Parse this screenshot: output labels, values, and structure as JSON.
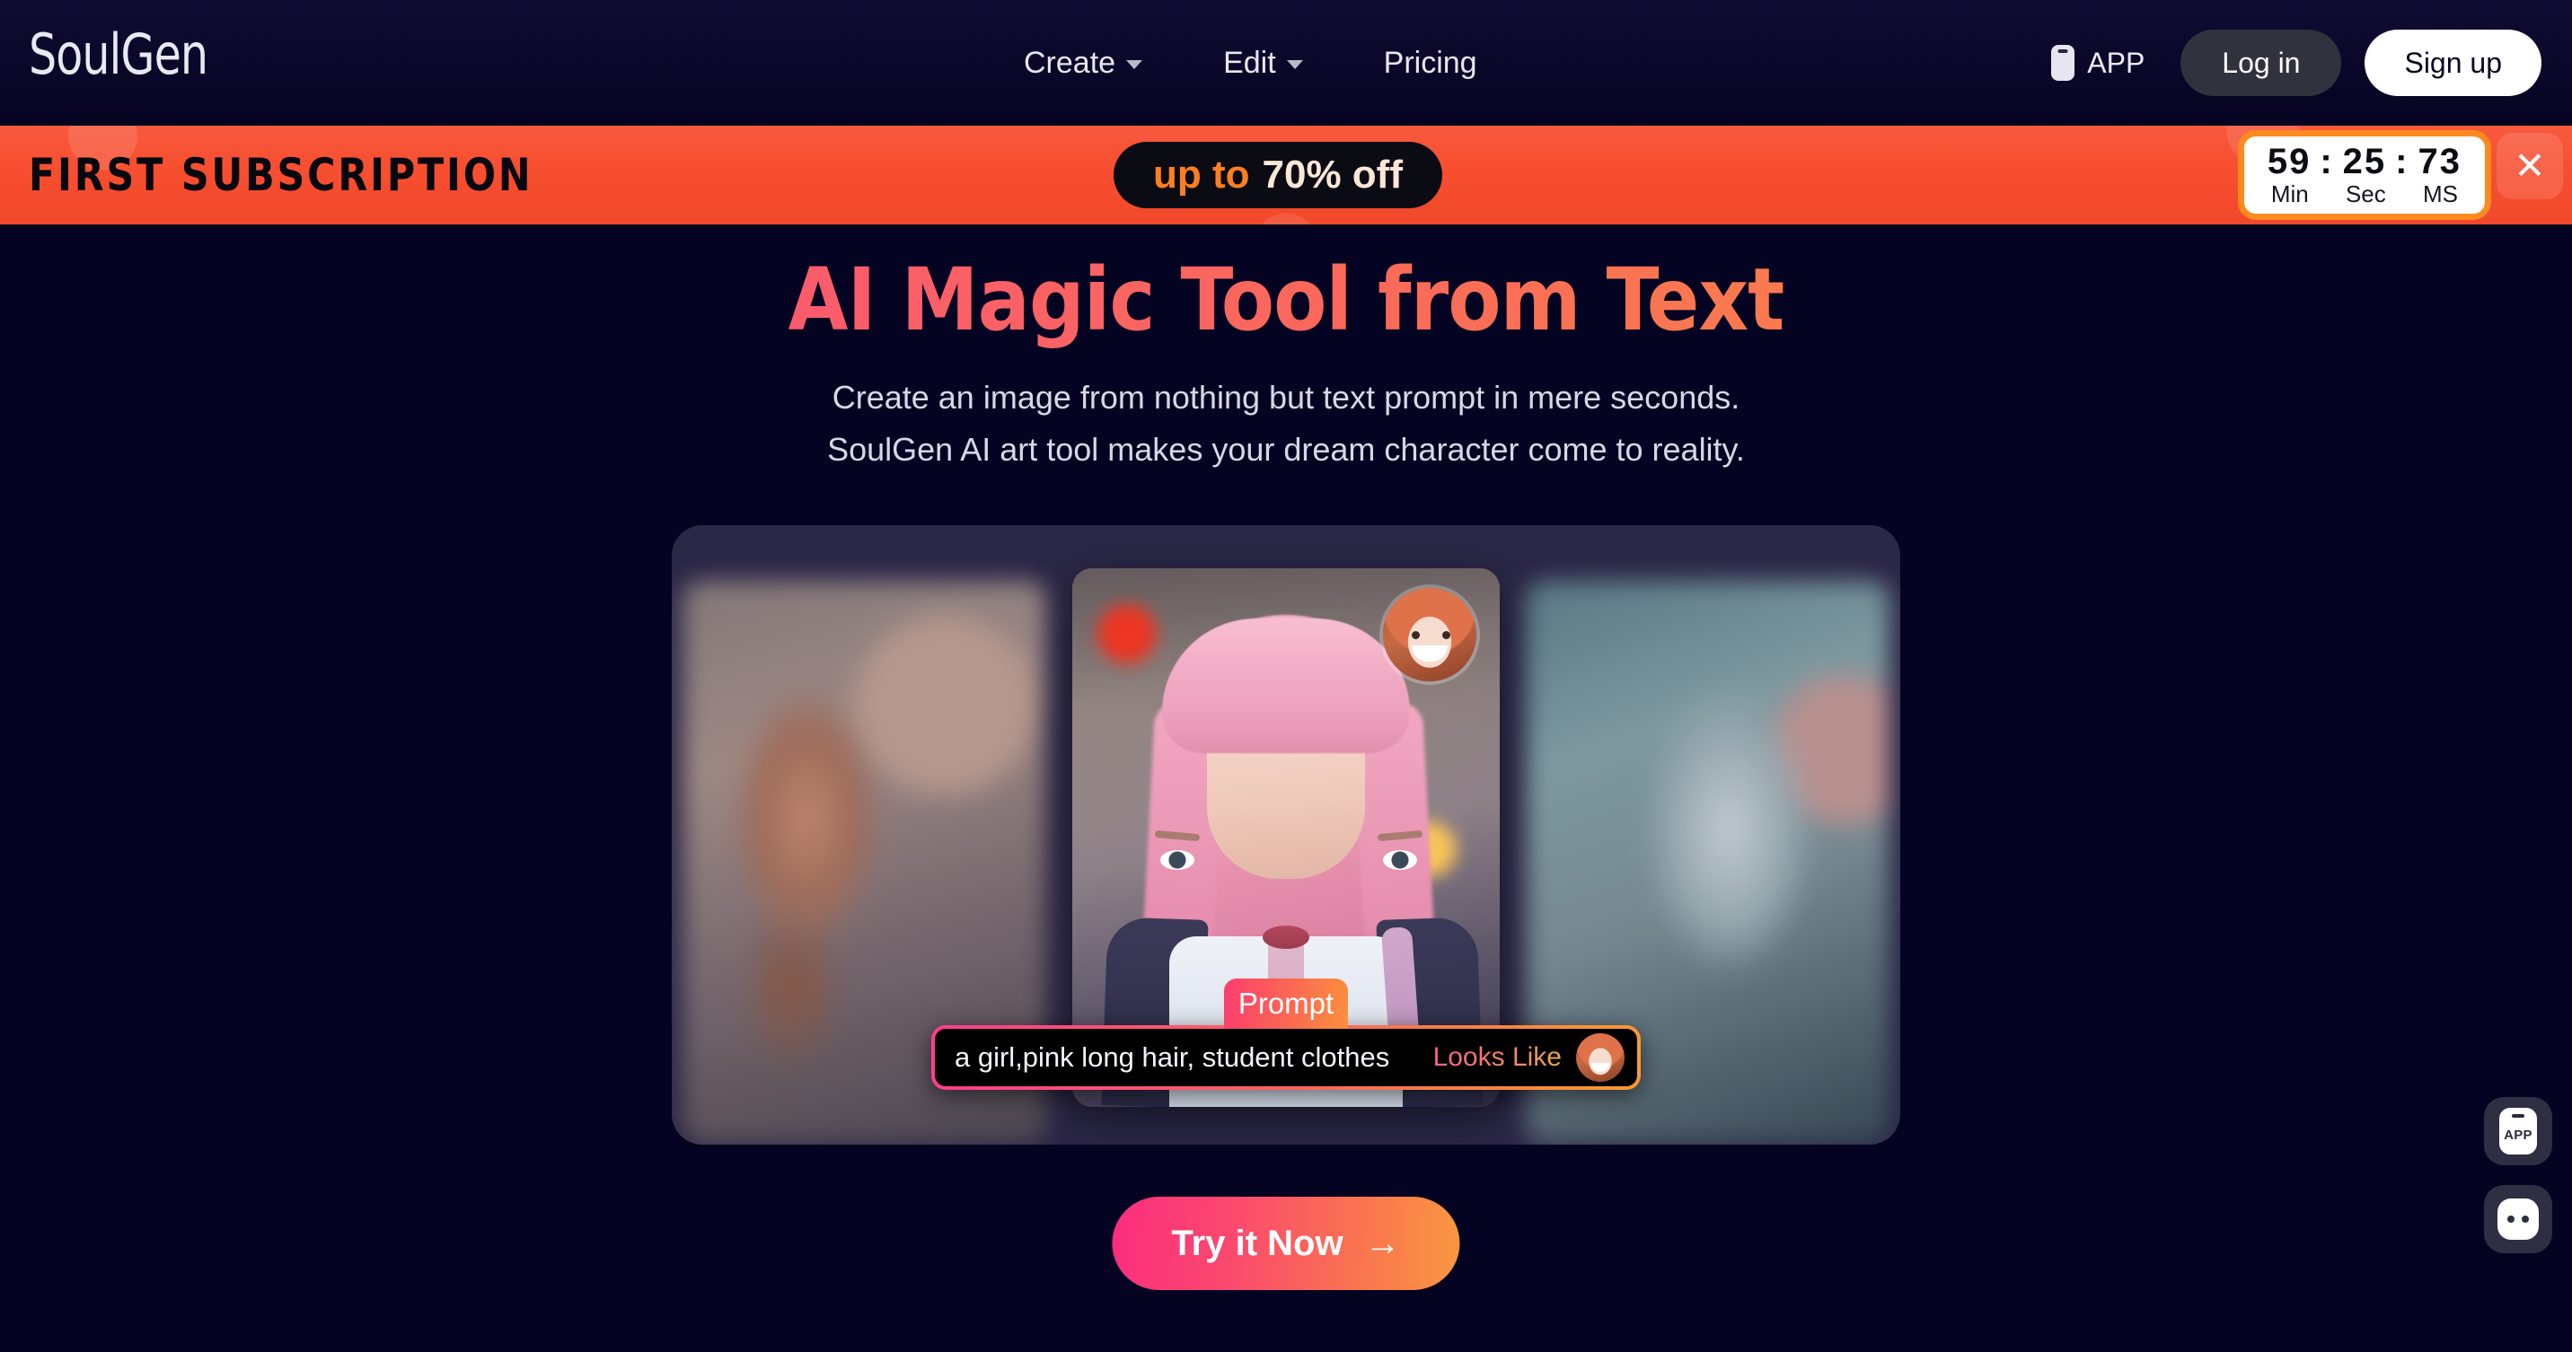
{
  "brand": {
    "name": "SoulGen"
  },
  "nav": {
    "items": [
      {
        "label": "Create",
        "has_caret": true
      },
      {
        "label": "Edit",
        "has_caret": true
      },
      {
        "label": "Pricing",
        "has_caret": false
      }
    ],
    "app_label": "APP",
    "login_label": "Log in",
    "signup_label": "Sign up"
  },
  "promo": {
    "title": "FIRST SUBSCRIPTION",
    "badge_prefix": "up to",
    "badge_discount": "70% off",
    "timer": {
      "minutes": "59",
      "seconds": "25",
      "milliseconds": "73",
      "sep1": ":",
      "sep2": ":",
      "label_min": "Min",
      "label_sec": "Sec",
      "label_ms": "MS"
    },
    "close_icon": "close-icon",
    "close_glyph": "✕",
    "colors": {
      "background": "#f74f30",
      "badge_bg": "#0b0b14",
      "accent": "#ff7f20",
      "timer_border": "#ff8a1f"
    }
  },
  "hero": {
    "title": "AI Magic Tool from Text",
    "subtitle_line1": "Create an image from nothing but text prompt in mere seconds.",
    "subtitle_line2": "SoulGen AI art tool makes your dream character come to reality.",
    "gradient_from": "#fb4a7f",
    "gradient_to": "#f8913f"
  },
  "carousel": {
    "slides": [
      {
        "name": "slide-left-blurred"
      },
      {
        "name": "slide-center-featured"
      },
      {
        "name": "slide-right-blurred"
      }
    ],
    "reference_avatar": "face-reference-avatar"
  },
  "prompt": {
    "tag_label": "Prompt",
    "value": "a girl,pink long hair, student clothes",
    "placeholder": "a girl,pink long hair, student clothes",
    "looks_like_label": "Looks Like",
    "avatar_name": "looks-like-avatar"
  },
  "cta": {
    "label": "Try it Now",
    "arrow": "→"
  },
  "floating": {
    "app_label": "APP",
    "chat_name": "chat-bubble-icon"
  },
  "theme": {
    "page_bg": "#050322",
    "nav_bg": "#0a0729",
    "carousel_bg": "#2b2747",
    "pink": "#fb3d6e",
    "orange": "#f99a2e"
  }
}
